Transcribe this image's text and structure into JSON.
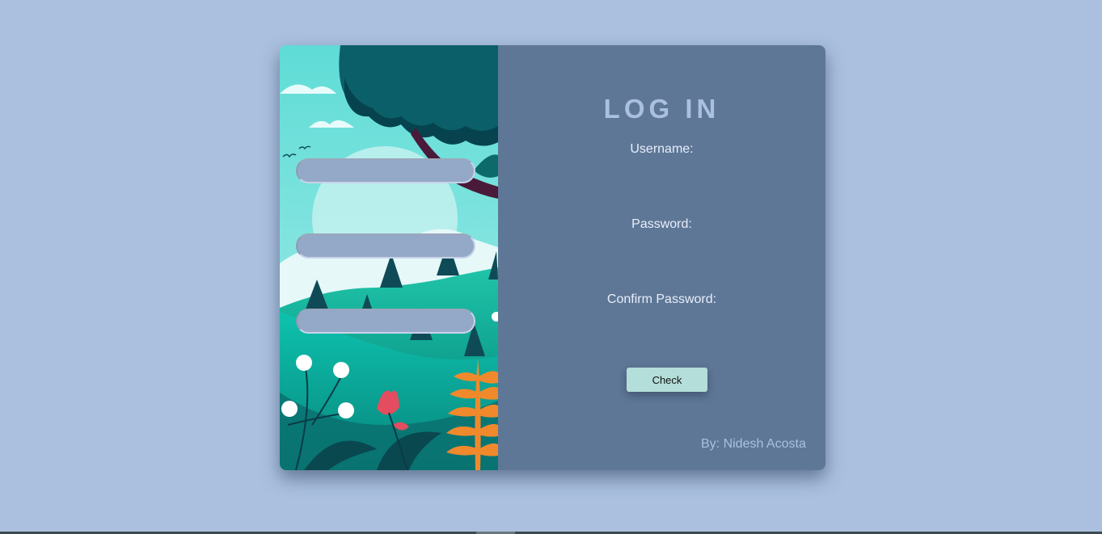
{
  "login": {
    "title": "LOG IN",
    "username_label": "Username:",
    "username_value": "",
    "password_label": "Password:",
    "password_value": "",
    "confirm_label": "Confirm Password:",
    "confirm_value": "",
    "check_button": "Check",
    "credit": "By: Nidesh Acosta"
  },
  "colors": {
    "background": "#aac0de",
    "panel": "#5e7796",
    "input": "#94a9c8",
    "button": "#b4ded9"
  },
  "illustration": {
    "icon": "landscape-illustration"
  }
}
